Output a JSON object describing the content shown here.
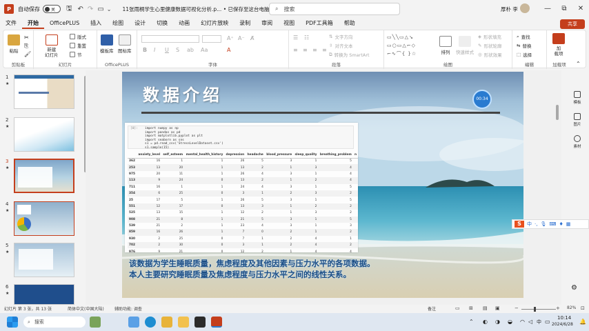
{
  "app": {
    "logo_text": "P",
    "autosave_label": "自动保存",
    "autosave_state": "关",
    "doc_title": "11张雨桐学生心里健康数据可视化分析.p... • 已保存至这台电脑 ∨",
    "search_placeholder": "搜索",
    "user_name": "厚朴 李",
    "window_min": "—",
    "window_max": "⧉",
    "window_close": "✕",
    "share_label": "共享"
  },
  "menu": [
    "文件",
    "开始",
    "OfficePLUS",
    "插入",
    "绘图",
    "设计",
    "切换",
    "动画",
    "幻灯片放映",
    "录制",
    "审阅",
    "视图",
    "PDF工具箱",
    "帮助"
  ],
  "menu_active_index": 1,
  "ribbon": {
    "clipboard": {
      "paste": "粘贴",
      "label": "剪贴板"
    },
    "slides": {
      "new_slide": "新建\n幻灯片",
      "layout": "版式",
      "reset": "重置",
      "section": "节",
      "label": "幻灯片"
    },
    "officeplus": {
      "template": "模板库",
      "icons": "图标库",
      "label": "OfficePLUS"
    },
    "font": {
      "label": "字体",
      "bold": "B",
      "italic": "I",
      "underline": "U",
      "strike": "S",
      "spacing": "ab",
      "case": "Aa",
      "color": "A"
    },
    "paragraph": {
      "label": "段落",
      "text_direction": "文字方向",
      "align_text": "对齐文本",
      "smartart": "转换为 SmartArt"
    },
    "drawing": {
      "label": "绘图",
      "arrange": "排列",
      "quick_styles": "快速样式",
      "fill": "形状填充",
      "outline": "形状轮廓",
      "effects": "形状效果"
    },
    "editing": {
      "label": "编辑",
      "find": "查找",
      "replace": "替换",
      "select": "选择"
    },
    "addins": {
      "label": "加载项",
      "addin": "加\n载项"
    }
  },
  "thumbnails": [
    {
      "num": "1",
      "star": "★"
    },
    {
      "num": "2",
      "star": "★"
    },
    {
      "num": "3",
      "star": "★",
      "selected": true
    },
    {
      "num": "4",
      "star": "★"
    },
    {
      "num": "5",
      "star": "★"
    },
    {
      "num": "6",
      "star": "★"
    }
  ],
  "slide": {
    "title": "数据介绍",
    "timer": "00:34",
    "code_line_no": "[0]:",
    "code": [
      "import numpy as np",
      "import pandas as pd",
      "import matplotlib.pyplot as plt",
      "import seaborn as sns",
      "s1 = pd.read_csv('StressLevelDataset.csv')",
      "s1.sample(15)"
    ],
    "table_headers": [
      "",
      "anxiety_level",
      "self_esteem",
      "mental_health_history",
      "depression",
      "headache",
      "blood_pressure",
      "sleep_quality",
      "breathing_problem",
      "n"
    ],
    "table_rows": [
      [
        "362",
        "16",
        "1",
        "1",
        "26",
        "5",
        "3",
        "1",
        "5",
        ""
      ],
      [
        "253",
        "13",
        "20",
        "1",
        "13",
        "2",
        "1",
        "3",
        "4",
        ""
      ],
      [
        "975",
        "20",
        "11",
        "1",
        "26",
        "4",
        "3",
        "1",
        "4",
        ""
      ],
      [
        "113",
        "9",
        "24",
        "0",
        "13",
        "2",
        "1",
        "2",
        "4",
        ""
      ],
      [
        "711",
        "16",
        "1",
        "1",
        "24",
        "4",
        "3",
        "1",
        "5",
        ""
      ],
      [
        "354",
        "6",
        "25",
        "0",
        "3",
        "1",
        "2",
        "3",
        "2",
        ""
      ],
      [
        "25",
        "17",
        "5",
        "1",
        "26",
        "5",
        "3",
        "1",
        "5",
        ""
      ],
      [
        "551",
        "12",
        "17",
        "0",
        "13",
        "3",
        "1",
        "2",
        "2",
        ""
      ],
      [
        "525",
        "13",
        "15",
        "1",
        "12",
        "2",
        "1",
        "3",
        "2",
        ""
      ],
      [
        "908",
        "21",
        "8",
        "1",
        "21",
        "5",
        "3",
        "1",
        "5",
        ""
      ],
      [
        "539",
        "21",
        "2",
        "1",
        "23",
        "4",
        "3",
        "1",
        "3",
        ""
      ],
      [
        "859",
        "16",
        "26",
        "1",
        "7",
        "0",
        "2",
        "1",
        "2",
        ""
      ],
      [
        "930",
        "2",
        "25",
        "0",
        "7",
        "1",
        "2",
        "4",
        "1",
        ""
      ],
      [
        "702",
        "2",
        "30",
        "0",
        "3",
        "1",
        "2",
        "4",
        "2",
        ""
      ],
      [
        "976",
        "9",
        "21",
        "0",
        "12",
        "2",
        "1",
        "4",
        "4",
        ""
      ]
    ],
    "caption_line1": "该数据为学生睡眠质量，焦虑程度及其他因素与压力水平的各项数据。",
    "caption_line2": "本人主要研究睡眠质量及焦虑程度与压力水平之间的线性关系。"
  },
  "right_pane": [
    {
      "label": "模板"
    },
    {
      "label": "图片"
    },
    {
      "label": "素材"
    }
  ],
  "ime": {
    "logo": "S",
    "mode": "中"
  },
  "status": {
    "slide_pos": "幻灯片 第 3 张，共 13 张",
    "language": "简体中文(中国大陆)",
    "accessibility": "辅助功能: 调查",
    "notes": "备注",
    "zoom": "82%"
  },
  "taskbar": {
    "search": "搜索",
    "time": "10:14",
    "date": "2024/6/28",
    "ime_indicator": "中",
    "colors": {
      "ppt": "#c43e1c",
      "accent": "#2a7bd0"
    }
  }
}
